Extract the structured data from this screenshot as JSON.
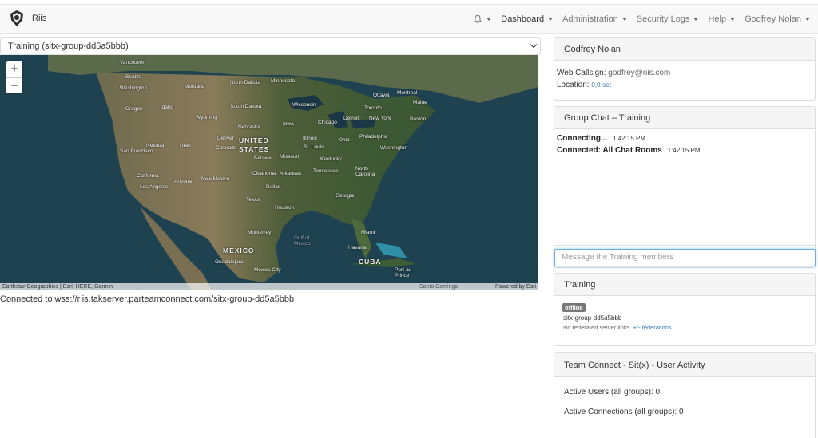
{
  "navbar": {
    "brand": "Riis",
    "items": [
      {
        "label": "Dashboard",
        "active": true
      },
      {
        "label": "Administration"
      },
      {
        "label": "Security Logs"
      },
      {
        "label": "Help"
      },
      {
        "label": "Godfrey Nolan"
      }
    ],
    "icons": {
      "logo": "riis-shield-logo",
      "notifications": "bell-icon"
    }
  },
  "group_select": {
    "value": "Training (sitx-group-dd5a5bbb)"
  },
  "map": {
    "zoom_in": "+",
    "zoom_out": "−",
    "attribution_left": "Earthstar Geographics | Esri, HERE, Garmin",
    "attribution_mid": "Santo Domingo",
    "attribution_right": "Powered by Esri",
    "labels": [
      "Vancouver",
      "Seattle",
      "Washington",
      "Montana",
      "North Dakota",
      "Minnesota",
      "Ottawa",
      "Montreal",
      "Maine",
      "Oregon",
      "Idaho",
      "South Dakota",
      "Wisconsin",
      "Toronto",
      "Boston",
      "Wyoming",
      "Nebraska",
      "Iowa",
      "Chicago",
      "Detroit",
      "New York",
      "Nevada",
      "Utah",
      "Denver",
      "Colorado",
      "Illinois",
      "Ohio",
      "Philadelphia",
      "UNITED STATES",
      "San Francisco",
      "Kansas",
      "Missouri",
      "St. Louis",
      "Kentucky",
      "Washington",
      "California",
      "Oklahoma",
      "Arkansas",
      "Tennessee",
      "North Carolina",
      "Los Angeles",
      "Arizona",
      "New Mexico",
      "Dallas",
      "Georgia",
      "Texas",
      "Houston",
      "Monterrey",
      "Gulf of Mexico",
      "Miami",
      "MEXICO",
      "Havana",
      "Guadalajara",
      "CUBA",
      "Mexico City",
      "Port-au-Prince"
    ]
  },
  "connection_status": "Connected to wss://riis.takserver.parteamconnect.com/sitx-group-dd5a5bbb",
  "profile": {
    "name": "Godfrey Nolan",
    "callsign_label": "Web Callsign:",
    "callsign": "godfrey@riis.com",
    "location_label": "Location:",
    "location_value": "0,0",
    "location_link": "set"
  },
  "chat": {
    "title": "Group Chat – Training",
    "messages": [
      {
        "text": "Connecting...",
        "time": "1:42:15 PM"
      },
      {
        "text": "Connected: All Chat Rooms",
        "time": "1:42:15 PM"
      }
    ],
    "input_placeholder": "Message the Training members"
  },
  "training": {
    "title": "Training",
    "badge": "offline",
    "group_id": "sitx-group-dd5a5bbb",
    "note": "No federated server links.",
    "note_link_prefix": "+/-",
    "note_link": "federations"
  },
  "activity": {
    "title": "Team Connect - Sit(x) - User Activity",
    "users_label": "Active Users (all groups): 0",
    "connections_label": "Active Connections (all groups): 0"
  },
  "colors": {
    "link": "#337ab7",
    "badge": "#777777",
    "focus": "#66afe9"
  }
}
